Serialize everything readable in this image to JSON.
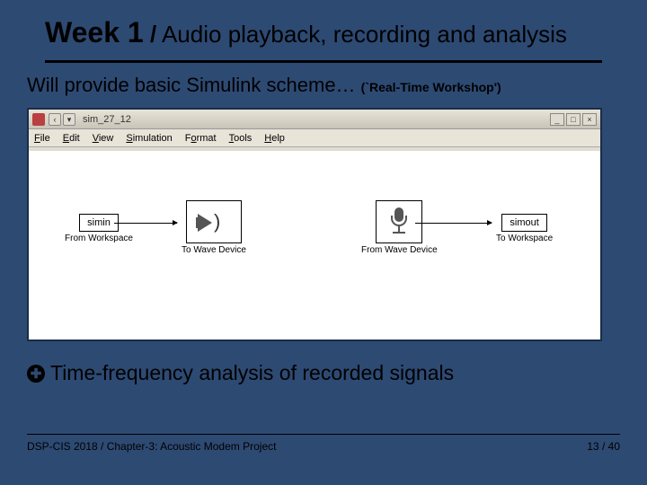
{
  "header": {
    "week": "Week 1",
    "sep": "/",
    "topic": "Audio playback, recording and analysis"
  },
  "subtitle": {
    "text": "Will provide basic Simulink scheme…  ",
    "note": "(`Real-Time Workshop')"
  },
  "simulink": {
    "title": "sim_27_12",
    "menu": [
      "File",
      "Edit",
      "View",
      "Simulation",
      "Format",
      "Tools",
      "Help"
    ],
    "blocks": {
      "simin": {
        "box": "simin",
        "label": "From\nWorkspace"
      },
      "towave": {
        "label": "To Wave\nDevice"
      },
      "fromwave": {
        "label": "From Wave\nDevice"
      },
      "simout": {
        "box": "simout",
        "label": "To Workspace"
      }
    }
  },
  "bullet": {
    "text": "Time-frequency analysis of recorded signals"
  },
  "footer": {
    "left": "DSP-CIS  2018  /   Chapter-3: Acoustic Modem Project",
    "right": "13 / 40"
  }
}
